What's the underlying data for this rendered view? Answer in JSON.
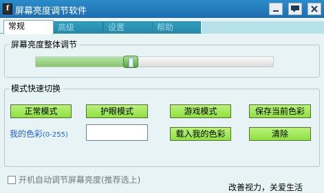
{
  "window": {
    "title": "屏幕亮度调节软件",
    "icon_char": "f",
    "controls": [
      "minimize-icon",
      "message-icon",
      "close-icon"
    ]
  },
  "tabs": [
    {
      "label": "常规",
      "active": true
    },
    {
      "label": "高级",
      "active": false
    },
    {
      "label": "设置",
      "active": false
    },
    {
      "label": "帮助",
      "active": false
    }
  ],
  "brightness": {
    "group_title": "屏幕亮度整体调节",
    "level_fraction": 0.4
  },
  "mode": {
    "group_title": "模式快速切换",
    "buttons": {
      "normal": "正常模式",
      "eye_care": "护眼模式",
      "game": "游戏模式",
      "save_color": "保存当前色彩",
      "load_color": "载入我的色彩",
      "clear": "清除"
    },
    "my_color_label": "我的色彩",
    "my_color_range": "(0-255)",
    "my_color_value": ""
  },
  "autostart": {
    "label": "开机自动调节屏幕亮度(推荐选上)",
    "checked": false
  },
  "slogan": "改善视力，关爱生活",
  "colors": {
    "titlebar": "#2c8bc9",
    "button_green": "#a6eb5e",
    "background": "#e8f3f5"
  }
}
